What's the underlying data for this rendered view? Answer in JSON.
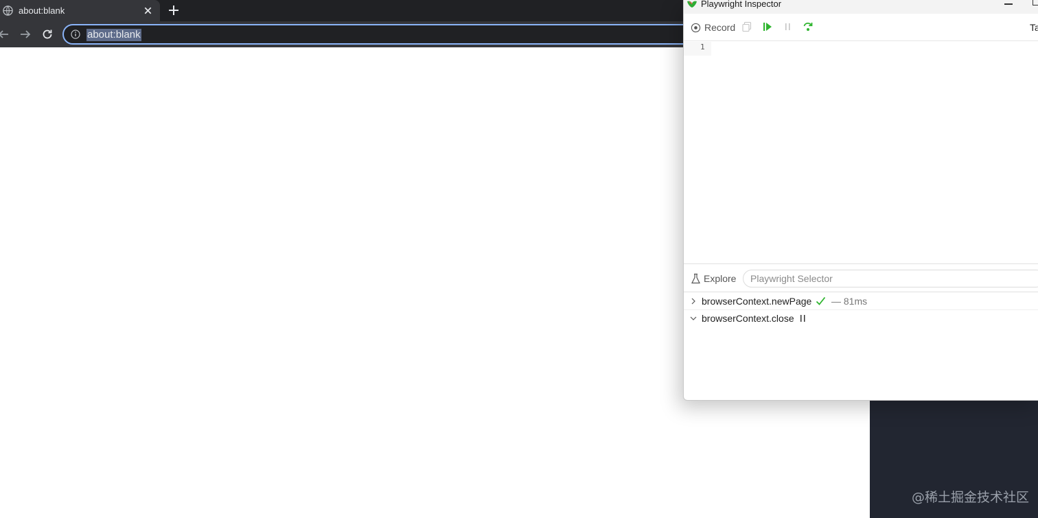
{
  "browser": {
    "tab": {
      "title": "about:blank"
    },
    "address": "about:blank"
  },
  "inspector": {
    "title": "Playwright Inspector",
    "toolbar": {
      "record_label": "Record",
      "target_label": "Ta"
    },
    "code": {
      "line_numbers": [
        "1"
      ]
    },
    "explore": {
      "label": "Explore",
      "placeholder": "Playwright Selector"
    },
    "call_log": [
      {
        "title": "browserContext.newPage",
        "status": "success",
        "duration": "— 81ms",
        "expanded": false
      },
      {
        "title": "browserContext.close",
        "status": "paused",
        "duration": "",
        "expanded": true
      }
    ]
  },
  "watermark": "@稀土掘金技术社区",
  "colors": {
    "chrome_dark": "#202124",
    "tab_active": "#35363a",
    "address_focus": "#8ab4f8",
    "green_accent": "#2fb52f"
  }
}
